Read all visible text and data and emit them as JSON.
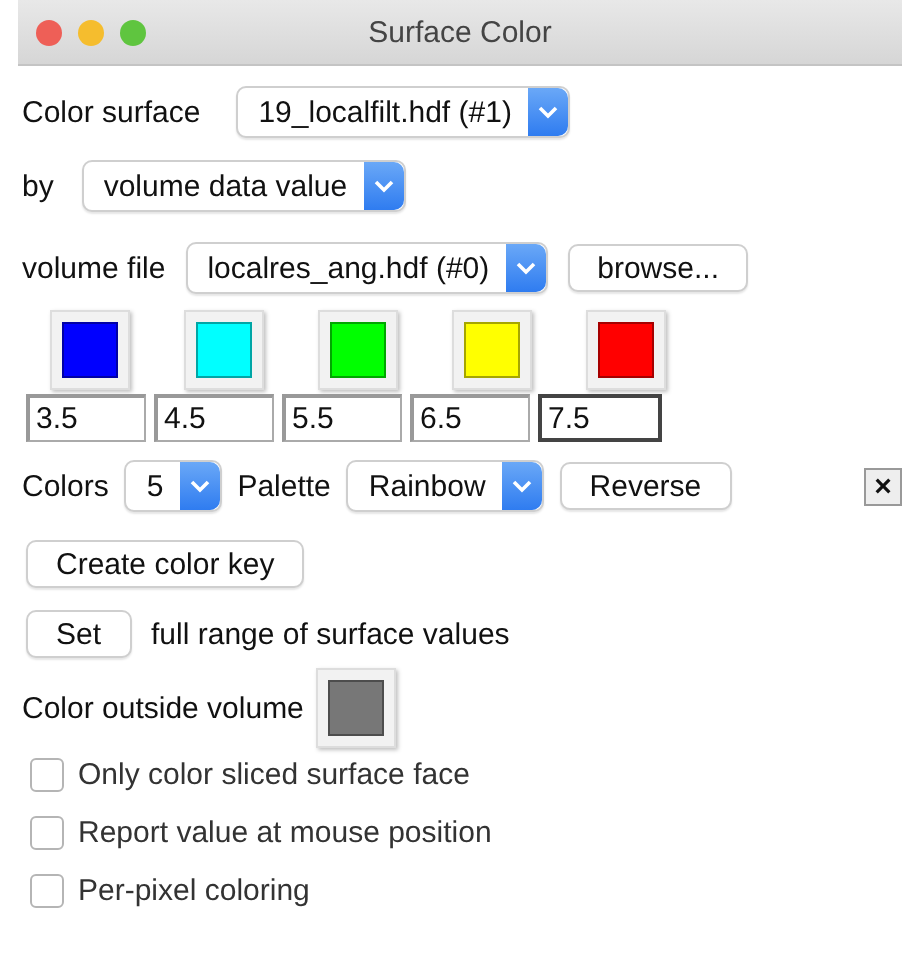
{
  "window": {
    "title": "Surface Color"
  },
  "color_surface": {
    "label": "Color surface",
    "value": "19_localfilt.hdf (#1)"
  },
  "by": {
    "label": "by",
    "value": "volume data value"
  },
  "volume_file": {
    "label": "volume file",
    "value": "localres_ang.hdf (#0)",
    "button": "browse..."
  },
  "thresholds": [
    {
      "color": "#0000ff",
      "value": "3.5",
      "focused": false
    },
    {
      "color": "#00ffff",
      "value": "4.5",
      "focused": false
    },
    {
      "color": "#00ff00",
      "value": "5.5",
      "focused": false
    },
    {
      "color": "#ffff00",
      "value": "6.5",
      "focused": false
    },
    {
      "color": "#ff0000",
      "value": "7.5",
      "focused": true
    }
  ],
  "colors": {
    "label": "Colors",
    "value": "5"
  },
  "palette": {
    "label": "Palette",
    "value": "Rainbow"
  },
  "reverse_button": "Reverse",
  "close_button": "×",
  "create_key_button": "Create color key",
  "set_button": "Set",
  "set_label": "full range of surface values",
  "outside": {
    "label": "Color outside volume",
    "color": "#777777"
  },
  "options": [
    {
      "label": "Only color sliced surface face",
      "checked": false
    },
    {
      "label": "Report value at mouse position",
      "checked": false
    },
    {
      "label": "Per-pixel coloring",
      "checked": false
    }
  ]
}
